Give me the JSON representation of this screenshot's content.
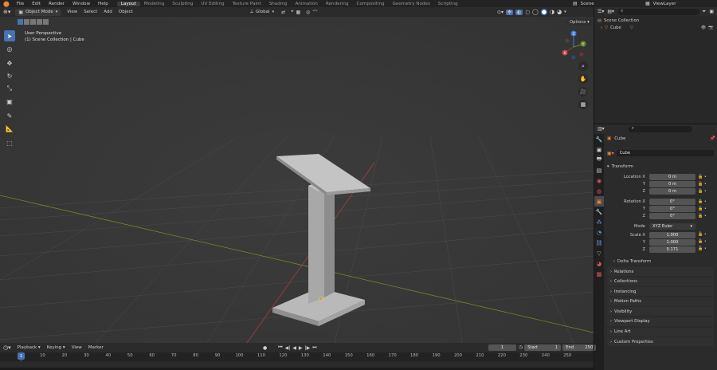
{
  "topbar": {
    "menus": [
      "File",
      "Edit",
      "Render",
      "Window",
      "Help"
    ],
    "workspaces": [
      "Layout",
      "Modeling",
      "Sculpting",
      "UV Editing",
      "Texture Paint",
      "Shading",
      "Animation",
      "Rendering",
      "Compositing",
      "Geometry Nodes",
      "Scripting"
    ],
    "active_workspace": "Layout",
    "scene": "Scene",
    "view_layer": "ViewLayer"
  },
  "viewport": {
    "mode": "Object Mode",
    "menus": [
      "View",
      "Select",
      "Add",
      "Object"
    ],
    "orientation": "Global",
    "options": "Options",
    "info_line1": "User Perspective",
    "info_line2": "(1) Scene Collection | Cube",
    "gizmo_labels": [
      "Z",
      "Y",
      "X"
    ],
    "colors": {
      "x_axis": "#a63f3f",
      "y_axis": "#6b8a2e",
      "z_axis": "#3f7ed1",
      "accent": "#4772b3"
    }
  },
  "outliner": {
    "search_placeholder": "",
    "root": "Scene Collection",
    "item": "Cube"
  },
  "properties": {
    "object_name": "Cube",
    "data_name": "Cube",
    "transform_title": "Transform",
    "location": {
      "label": "Location X",
      "x": "0 m",
      "y": "0 m",
      "z": "0 m"
    },
    "rotation": {
      "label": "Rotation X",
      "x": "0°",
      "y": "0°",
      "z": "0°"
    },
    "mode_label": "Mode",
    "mode_value": "XYZ Euler",
    "scale": {
      "label": "Scale X",
      "x": "1.000",
      "y": "1.000",
      "z": "0.171"
    },
    "axis_y": "Y",
    "axis_z": "Z",
    "delta": "Delta Transform",
    "panels": [
      "Relations",
      "Collections",
      "Instancing",
      "Motion Paths",
      "Visibility",
      "Viewport Display",
      "Line Art",
      "Custom Properties"
    ]
  },
  "timeline": {
    "menus": [
      "Playback",
      "Keying",
      "View",
      "Marker"
    ],
    "current_frame": "1",
    "start_label": "Start",
    "start": "1",
    "end_label": "End",
    "end": "250",
    "ticks": [
      "0",
      "10",
      "20",
      "30",
      "40",
      "50",
      "60",
      "70",
      "80",
      "90",
      "100",
      "110",
      "120",
      "130",
      "140",
      "150",
      "160",
      "170",
      "180",
      "190",
      "200",
      "210",
      "220",
      "230",
      "240",
      "250"
    ]
  }
}
